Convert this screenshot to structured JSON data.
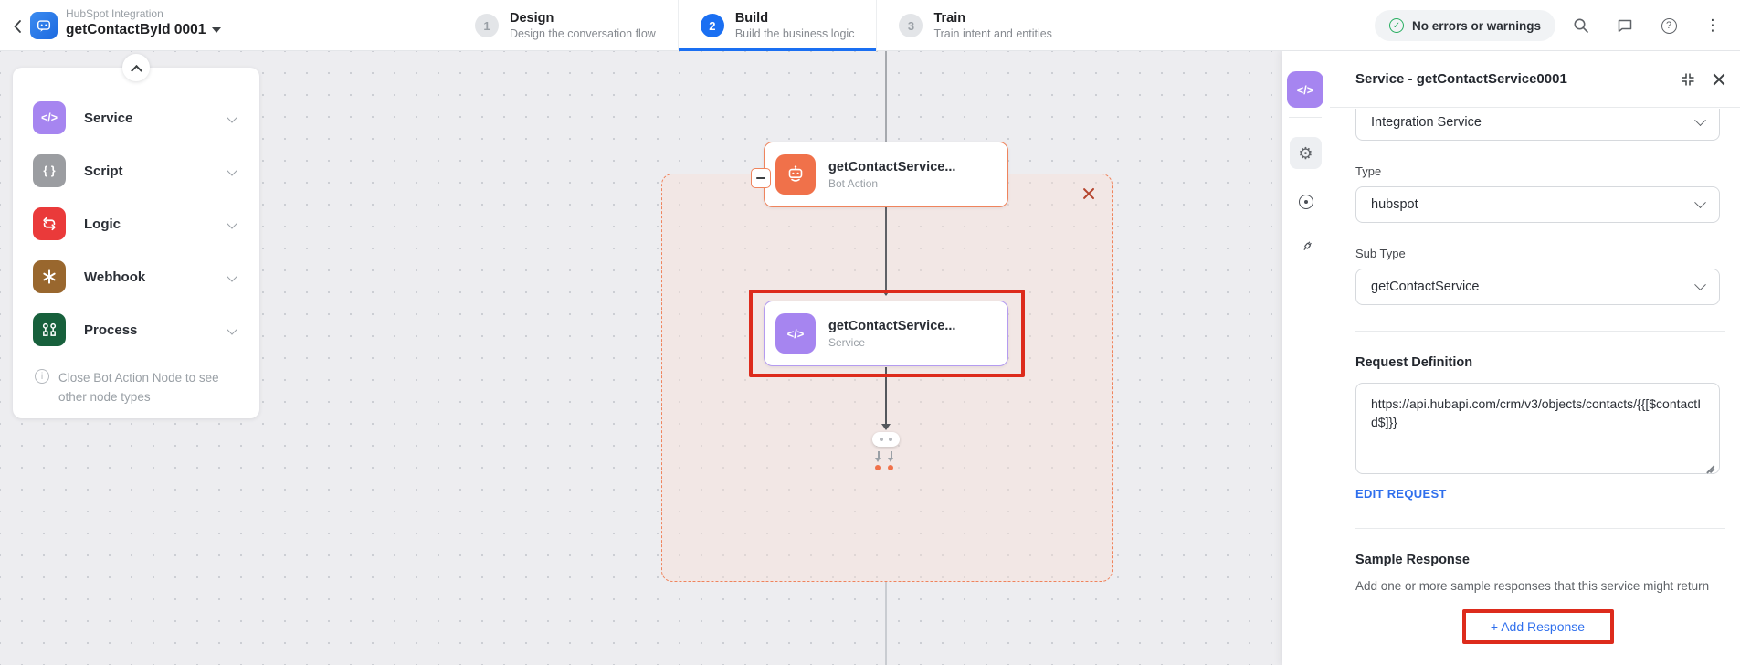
{
  "header": {
    "app_subtitle": "HubSpot Integration",
    "app_title": "getContactById 0001",
    "status_badge": "No errors or warnings",
    "tabs": [
      {
        "num": "1",
        "label": "Design",
        "sub": "Design the conversation flow"
      },
      {
        "num": "2",
        "label": "Build",
        "sub": "Build the business logic"
      },
      {
        "num": "3",
        "label": "Train",
        "sub": "Train intent and entities"
      }
    ]
  },
  "icons": {
    "check": "✓",
    "help": "?",
    "info": "i",
    "kebab": "⋮",
    "gear": "⚙"
  },
  "sidebar": {
    "items": [
      {
        "label": "Service",
        "glyph": "</>",
        "color": "#a685f0",
        "icon": "code-icon"
      },
      {
        "label": "Script",
        "glyph": "{ }",
        "color": "#9b9da1",
        "icon": "braces-icon"
      },
      {
        "label": "Logic",
        "glyph": "",
        "color": "#ea3a3a",
        "icon": "loop-icon"
      },
      {
        "label": "Webhook",
        "glyph": "",
        "color": "#99672e",
        "icon": "webhook-icon"
      },
      {
        "label": "Process",
        "glyph": "",
        "color": "#17603c",
        "icon": "process-icon"
      }
    ],
    "note": "Close Bot Action Node to see other node types"
  },
  "canvas": {
    "bot_action_node": {
      "title": "getContactService...",
      "subtitle": "Bot Action"
    },
    "service_node": {
      "title": "getContactService...",
      "subtitle": "Service",
      "glyph": "</>"
    }
  },
  "panel": {
    "rail_glyph": "</>",
    "title": "Service - getContactService0001",
    "connection_type_value": "Integration Service",
    "type_label": "Type",
    "type_value": "hubspot",
    "subtype_label": "Sub Type",
    "subtype_value": "getContactService",
    "request_definition_label": "Request Definition",
    "request_definition_value": "https://api.hubapi.com/crm/v3/objects/contacts/{{[$contactId$]}}",
    "edit_request_label": "EDIT REQUEST",
    "sample_response_label": "Sample Response",
    "sample_response_desc": "Add one or more sample responses that this service might return",
    "add_response_label": "+ Add Response"
  },
  "colors": {
    "accent_blue": "#1a6ff2",
    "link_blue": "#2f6fed",
    "success_green": "#27ae60",
    "bot_action_orange": "#f0714a",
    "service_purple": "#a685f0",
    "group_dashed_border": "#ef845d",
    "annotation_red": "#dd2b1c"
  }
}
